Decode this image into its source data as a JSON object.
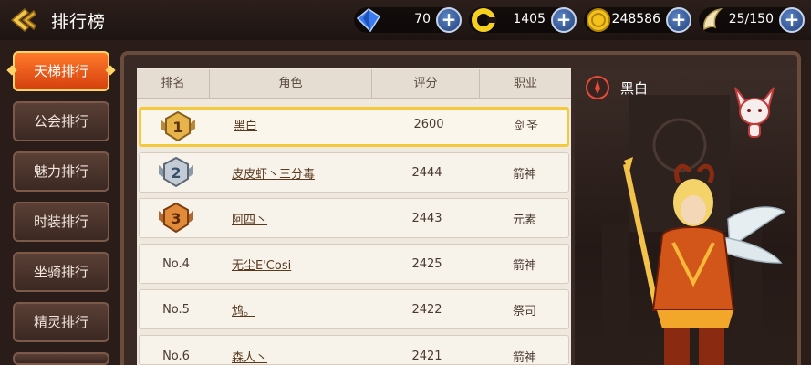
{
  "header": {
    "title": "排行榜",
    "resources": [
      {
        "icon": "blue-gem-icon",
        "value": "70"
      },
      {
        "icon": "yellow-ring-icon",
        "value": "1405"
      },
      {
        "icon": "gold-coin-icon",
        "value": "248586"
      },
      {
        "icon": "wing-energy-icon",
        "value": "25/150"
      }
    ],
    "plus_label": "+"
  },
  "sidebar": {
    "items": [
      {
        "label": "天梯排行",
        "active": true
      },
      {
        "label": "公会排行",
        "active": false
      },
      {
        "label": "魅力排行",
        "active": false
      },
      {
        "label": "时装排行",
        "active": false
      },
      {
        "label": "坐骑排行",
        "active": false
      },
      {
        "label": "精灵排行",
        "active": false
      }
    ]
  },
  "table": {
    "columns": [
      "排名",
      "角色",
      "评分",
      "职业"
    ],
    "rows": [
      {
        "rank": "1",
        "medal": "gold",
        "name": "黑白",
        "score": "2600",
        "job": "剑圣",
        "selected": true
      },
      {
        "rank": "2",
        "medal": "silver",
        "name": "皮皮虾丶三分毒",
        "score": "2444",
        "job": "箭神"
      },
      {
        "rank": "3",
        "medal": "bronze",
        "name": "阿四丶",
        "score": "2443",
        "job": "元素"
      },
      {
        "rank": "No.4",
        "name": "无尘E'Cosi",
        "score": "2425",
        "job": "箭神"
      },
      {
        "rank": "No.5",
        "name": "鸩。",
        "score": "2422",
        "job": "祭司"
      },
      {
        "rank": "No.6",
        "name": "森人丶",
        "score": "2421",
        "job": "箭神"
      }
    ]
  },
  "preview": {
    "name": "黑白",
    "class_icon": "swordsman-class-icon",
    "pet_icon": "fox-pet-icon"
  },
  "colors": {
    "accent": "#ff7a2a",
    "selected_border": "#f4c93c",
    "plus_button": "#2e5296"
  }
}
